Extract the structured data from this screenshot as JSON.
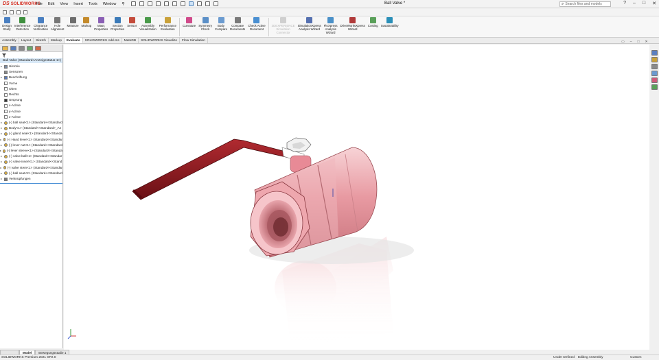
{
  "app": {
    "logo_ds": "DS",
    "logo_name": "SOLIDWORKS",
    "menu": [
      "File",
      "Edit",
      "View",
      "Insert",
      "Tools",
      "Window"
    ],
    "document_title": "Ball Valve *",
    "search_placeholder": "Search files and models"
  },
  "command_manager": {
    "groups": [
      [
        {
          "label": "Design\nStudy",
          "icon": "design-study-icon",
          "color": "#4a7fc1"
        },
        {
          "label": "Interference\nDetection",
          "icon": "interference-icon",
          "color": "#3e8f3e"
        },
        {
          "label": "Clearance\nVerification",
          "icon": "clearance-icon",
          "color": "#4a7fc1"
        },
        {
          "label": "Hole\nAlignment",
          "icon": "hole-alignment-icon",
          "color": "#777777"
        },
        {
          "label": "Measure",
          "icon": "measure-icon",
          "color": "#6d6d6d"
        },
        {
          "label": "Markup",
          "icon": "markup-icon",
          "color": "#c48a2b"
        },
        {
          "label": "Mass\nProperties",
          "icon": "mass-properties-icon",
          "color": "#8a5fb5"
        },
        {
          "label": "Section\nProperties",
          "icon": "section-properties-icon",
          "color": "#3b7ab8"
        },
        {
          "label": "Sensor",
          "icon": "sensor-icon",
          "color": "#c44b3b"
        },
        {
          "label": "Assembly\nVisualization",
          "icon": "assembly-visualization-icon",
          "color": "#4a9a4a"
        },
        {
          "label": "Performance\nEvaluation",
          "icon": "performance-icon",
          "color": "#c9a13a"
        }
      ],
      [
        {
          "label": "Curvature",
          "icon": "curvature-icon",
          "color": "#d04a8a"
        },
        {
          "label": "Symmetry\nCheck",
          "icon": "symmetry-icon",
          "color": "#5b8fc7"
        },
        {
          "label": "Body\nCompare",
          "icon": "body-compare-icon",
          "color": "#6b9bd0"
        },
        {
          "label": "Compare\nDocuments",
          "icon": "compare-documents-icon",
          "color": "#7a7a7a"
        },
        {
          "label": "Check Active\nDocument",
          "icon": "check-document-icon",
          "color": "#4a8fd1"
        }
      ],
      [
        {
          "label": "3DEXPERIENCE\nSimulation\nConnector",
          "icon": "simulation-connector-icon",
          "color": "#cfcfcf",
          "disabled": true
        },
        {
          "label": "SimulationXpress\nAnalysis Wizard",
          "icon": "simulationxpress-icon",
          "color": "#5570b0"
        },
        {
          "label": "FloXpress\nAnalysis\nWizard",
          "icon": "floxpress-icon",
          "color": "#4a90c8"
        },
        {
          "label": "DriveWorksXpress\nWizard",
          "icon": "driveworks-icon",
          "color": "#b03a3a"
        },
        {
          "label": "Costing",
          "icon": "costing-icon",
          "color": "#5aa05a"
        },
        {
          "label": "Sustainability",
          "icon": "sustainability-icon",
          "color": "#2a8fb8"
        }
      ]
    ]
  },
  "tabs": [
    "Assembly",
    "Layout",
    "Sketch",
    "Markup",
    "Evaluate",
    "SOLIDWORKS Add-Ins",
    "MateDB",
    "SOLIDWORKS Visualize",
    "Flow Simulation"
  ],
  "active_tab": "Evaluate",
  "tree": {
    "root": "Ball Valve  (Standard<Anzeigestatus-1>)",
    "items": [
      {
        "label": "Historie",
        "icon": "history-icon",
        "arrow": true
      },
      {
        "label": "Sensoren",
        "icon": "sensor-folder-icon",
        "arrow": false
      },
      {
        "label": "Beschriftung",
        "icon": "annotation-icon",
        "arrow": true
      },
      {
        "label": "Vorne",
        "icon": "plane-icon",
        "arrow": false
      },
      {
        "label": "Oben",
        "icon": "plane-icon",
        "arrow": false
      },
      {
        "label": "Rechts",
        "icon": "plane-icon",
        "arrow": false
      },
      {
        "label": "Ursprung",
        "icon": "origin-icon",
        "arrow": false
      },
      {
        "label": "x-Achse",
        "icon": "axis-icon",
        "arrow": false
      },
      {
        "label": "y-Achse",
        "icon": "axis-icon",
        "arrow": false
      },
      {
        "label": "z-Achse",
        "icon": "axis-icon",
        "arrow": false
      },
      {
        "label": "(-) ball seat<1> (Standard<<Standard",
        "icon": "part-icon",
        "arrow": true
      },
      {
        "label": "Body<1> (Standard<<Standard>_An",
        "icon": "part-icon",
        "arrow": true
      },
      {
        "label": "(-) gland seal<1> (Standard<<Standa",
        "icon": "part-icon",
        "arrow": true
      },
      {
        "label": "(-) Hand lever<1> (Standard<<Standar",
        "icon": "part-icon",
        "arrow": true
      },
      {
        "label": "(-) lever nut<1> (Standard<<Standard",
        "icon": "part-icon",
        "arrow": true
      },
      {
        "label": "(-) lever sleeve<1> (Standard<<Standa",
        "icon": "part-icon",
        "arrow": true
      },
      {
        "label": "(-) valve ball<1> (Standard<<Standar",
        "icon": "part-icon",
        "arrow": true
      },
      {
        "label": "(-) valve insert<1> (Standard<<Stand",
        "icon": "part-icon",
        "arrow": true
      },
      {
        "label": "(-) valve stem<1> (Standard<<Standar",
        "icon": "part-icon",
        "arrow": true
      },
      {
        "label": "(-) ball seat<2> (Standard<<Standard",
        "icon": "part-icon",
        "arrow": true
      },
      {
        "label": "Verknüpfungen",
        "icon": "mates-icon",
        "arrow": true
      }
    ]
  },
  "bottom_tabs": [
    "Model",
    "Bewegungsstudie 1"
  ],
  "active_bottom_tab": "Model",
  "status": {
    "product": "SOLIDWORKS Premium 2021 SP2.0",
    "defined": "Under Defined",
    "mode": "Editing Assembly",
    "units": "Custom"
  },
  "colors": {
    "lever": "#8b1a1f",
    "body": "#e8a0a6",
    "accent": "#d52b1e"
  }
}
